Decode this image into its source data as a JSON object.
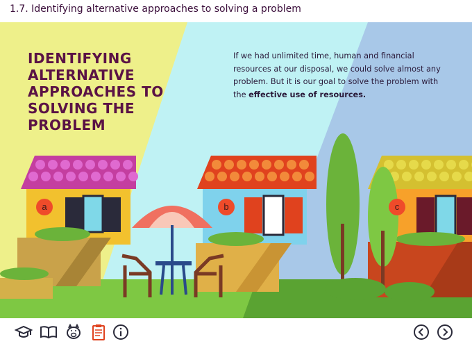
{
  "header": {
    "title": "1.7. Identifying alternative approaches to solving a problem"
  },
  "main": {
    "heading": "IDENTIFYING\nALTERNATIVE\nAPPROACHES TO\nSOLVING THE PROBLEM",
    "paragraph": {
      "text": "If we had unlimited time, human and financial resources at our disposal, we could solve almost any problem. But it is our goal to solve the problem with the ",
      "bold": "effective use of resources."
    },
    "markers": [
      "a",
      "b",
      "c"
    ]
  },
  "footer": {
    "icons": [
      "graduation-cap-icon",
      "open-book-icon",
      "piggy-bank-icon",
      "clipboard-icon",
      "info-icon"
    ],
    "nav": [
      "previous-arrow-icon",
      "next-arrow-icon"
    ]
  },
  "colors": {
    "title": "#3a0d3a",
    "heading": "#5a1245",
    "panel_a": "#eef08a",
    "panel_b": "#bff2f4",
    "panel_c": "#a8c8e8",
    "marker": "#ef4b2a"
  }
}
